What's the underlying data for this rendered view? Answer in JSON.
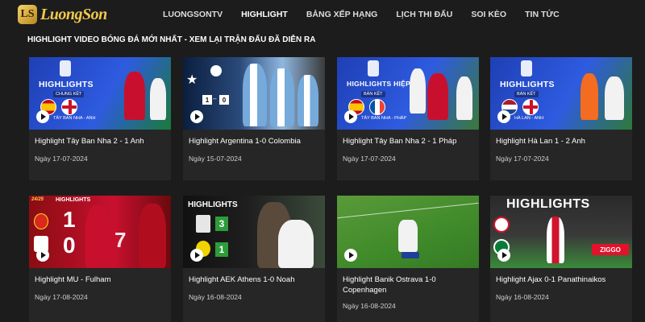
{
  "brand": {
    "name": "LuongSon"
  },
  "nav": [
    {
      "label": "LUONGSONTV"
    },
    {
      "label": "HIGHLIGHT"
    },
    {
      "label": "BẢNG XẾP HẠNG"
    },
    {
      "label": "LỊCH THI ĐẤU"
    },
    {
      "label": "SOI KÈO"
    },
    {
      "label": "TIN TỨC"
    }
  ],
  "section_title": "HIGHLIGHT VIDEO BÓNG ĐÁ MỚI NHẤT - XEM LẠI TRẬN ĐẤU ĐÃ DIỄN RA",
  "cards": [
    {
      "title": "Highlight Tây Ban Nha 2 - 1 Anh",
      "date": "Ngày 17-07-2024",
      "thumb_heading": "HIGHLIGHTS",
      "thumb_sub": "CHUNG KẾT",
      "thumb_caption": "TÂY BAN NHA - ANH",
      "thumb_icon": "euro-2024-trophy-icon"
    },
    {
      "title": "Highlight Argentina 1-0 Colombia",
      "date": "Ngày 15-07-2024",
      "thumb_score": [
        "1",
        "0"
      ],
      "thumb_icon": "copa-america-icon"
    },
    {
      "title": "Highlight Tây Ban Nha 2 - 1 Pháp",
      "date": "Ngày 17-07-2024",
      "thumb_heading": "HIGHLIGHTS HIỆP 1",
      "thumb_sub": "BÁN KẾT",
      "thumb_caption": "TÂY BAN NHA - PHÁP",
      "thumb_icon": "euro-2024-trophy-icon"
    },
    {
      "title": "Highlight Hà Lan 1 - 2 Anh",
      "date": "Ngày 17-07-2024",
      "thumb_heading": "HIGHLIGHTS",
      "thumb_sub": "BÁN KẾT",
      "thumb_caption": "HÀ LAN - ANH",
      "thumb_icon": "euro-2024-trophy-icon"
    },
    {
      "title": "Highlight MU - Fulham",
      "date": "Ngày 17-08-2024",
      "thumb_heading": "HIGHLIGHTS",
      "thumb_season": "24/25",
      "thumb_score": [
        "1",
        "0"
      ],
      "thumb_extra": "7"
    },
    {
      "title": "Highlight AEK Athens 1-0 Noah",
      "date": "Ngày 16-08-2024",
      "thumb_heading": "HIGHLIGHTS",
      "thumb_score": [
        "3",
        "1"
      ]
    },
    {
      "title": "Highlight Banik Ostrava 1-0 Copenhagen",
      "date": "Ngày 16-08-2024"
    },
    {
      "title": "Highlight Ajax 0-1 Panathinaikos",
      "date": "Ngày 16-08-2024",
      "thumb_heading": "HIGHLIGHTS",
      "thumb_sponsor": "ZIGGO"
    }
  ],
  "colors": {
    "background": "#1c1c1c",
    "card": "#262626",
    "brand_gold": "#f2c94c"
  }
}
